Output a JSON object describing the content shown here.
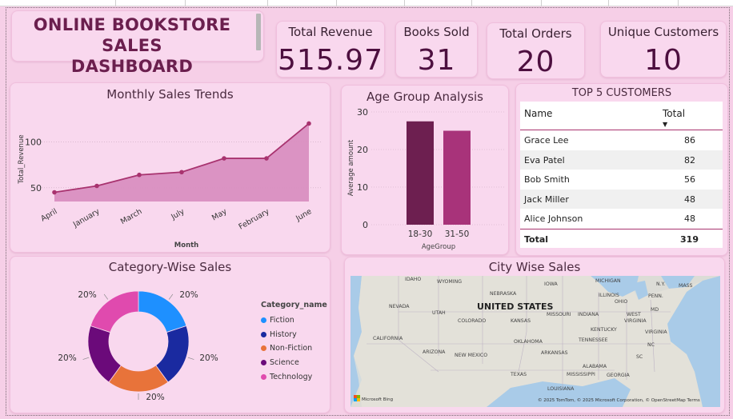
{
  "dashboard": {
    "title_line1": "ONLINE BOOKSTORE SALES",
    "title_line2": "DASHBOARD"
  },
  "kpis": [
    {
      "label": "Total Revenue",
      "value": "515.97"
    },
    {
      "label": "Books Sold",
      "value": "31"
    },
    {
      "label": "Total Orders",
      "value": "20"
    },
    {
      "label": "Unique Customers",
      "value": "10"
    }
  ],
  "monthly": {
    "title": "Monthly Sales Trends"
  },
  "age": {
    "title": "Age Group Analysis"
  },
  "category": {
    "title": "Category-Wise Sales",
    "legend_title": "Category_name"
  },
  "city": {
    "title": "City Wise Sales",
    "country_label": "UNITED STATES",
    "states": [
      {
        "name": "IDAHO"
      },
      {
        "name": "WYOMING"
      },
      {
        "name": "IOWA"
      },
      {
        "name": "MICHIGAN"
      },
      {
        "name": "N.Y."
      },
      {
        "name": "MASS"
      },
      {
        "name": "NEBRASKA"
      },
      {
        "name": "ILLINOIS"
      },
      {
        "name": "OHIO"
      },
      {
        "name": "PENN."
      },
      {
        "name": "NEVADA"
      },
      {
        "name": "UTAH"
      },
      {
        "name": "COLORADO"
      },
      {
        "name": "KANSAS"
      },
      {
        "name": "MISSOURI"
      },
      {
        "name": "INDIANA"
      },
      {
        "name": "WEST"
      },
      {
        "name": "VIRGINIA"
      },
      {
        "name": "MD"
      },
      {
        "name": "KENTUCKY"
      },
      {
        "name": "VIRGINIA"
      },
      {
        "name": "CALIFORNIA"
      },
      {
        "name": "OKLAHOMA"
      },
      {
        "name": "TENNESSEE"
      },
      {
        "name": "ARIZONA"
      },
      {
        "name": "NEW MEXICO"
      },
      {
        "name": "ARKANSAS"
      },
      {
        "name": "NC"
      },
      {
        "name": "SC"
      },
      {
        "name": "ALABAMA"
      },
      {
        "name": "TEXAS"
      },
      {
        "name": "MISSISSIPPI"
      },
      {
        "name": "GEORGIA"
      },
      {
        "name": "LOUISIANA"
      }
    ],
    "attribution": "© 2025 TomTom, © 2025 Microsoft Corporation, © OpenStreetMap  Terms",
    "bing_label": "Microsoft Bing"
  },
  "top_customers": {
    "title": "TOP 5 CUSTOMERS",
    "col_name": "Name",
    "col_total": "Total",
    "rows": [
      {
        "name": "Grace Lee",
        "total": "86"
      },
      {
        "name": "Eva Patel",
        "total": "82"
      },
      {
        "name": "Bob Smith",
        "total": "56"
      },
      {
        "name": "Jack Miller",
        "total": "48"
      },
      {
        "name": "Alice Johnson",
        "total": "48"
      }
    ],
    "footer_label": "Total",
    "footer_value": "319"
  },
  "colors": {
    "accent": "#a8336f",
    "area_fill": "#d98fc0",
    "bar_dark": "#6d1f50",
    "bar_light": "#a8337a",
    "fiction": "#1e90ff",
    "history": "#1a2aa0",
    "non_fiction": "#e8733a",
    "science": "#6b0a7a",
    "technology": "#e04aae"
  },
  "chart_data": [
    {
      "type": "area",
      "title": "Monthly Sales Trends",
      "xlabel": "Month",
      "ylabel": "Total_Revenue",
      "categories": [
        "April",
        "January",
        "March",
        "July",
        "May",
        "February",
        "June"
      ],
      "values": [
        45,
        52,
        64,
        67,
        82,
        82,
        120
      ],
      "yticks": [
        50,
        100
      ],
      "ylim": [
        35,
        130
      ],
      "grid": true
    },
    {
      "type": "bar",
      "title": "Age Group Analysis",
      "xlabel": "AgeGroup",
      "ylabel": "Average amount",
      "categories": [
        "18-30",
        "31-50"
      ],
      "values": [
        27.5,
        25
      ],
      "yticks": [
        0,
        10,
        20,
        30
      ],
      "ylim": [
        0,
        30
      ],
      "grid": true
    },
    {
      "type": "pie",
      "title": "Category-Wise Sales",
      "donut": true,
      "legend_title": "Category_name",
      "legend_position": "right",
      "categories": [
        "Fiction",
        "History",
        "Non-Fiction",
        "Science",
        "Technology"
      ],
      "values": [
        20,
        20,
        20,
        20,
        20
      ],
      "labels": [
        "20%",
        "20%",
        "20%",
        "20%",
        "20%"
      ]
    }
  ]
}
